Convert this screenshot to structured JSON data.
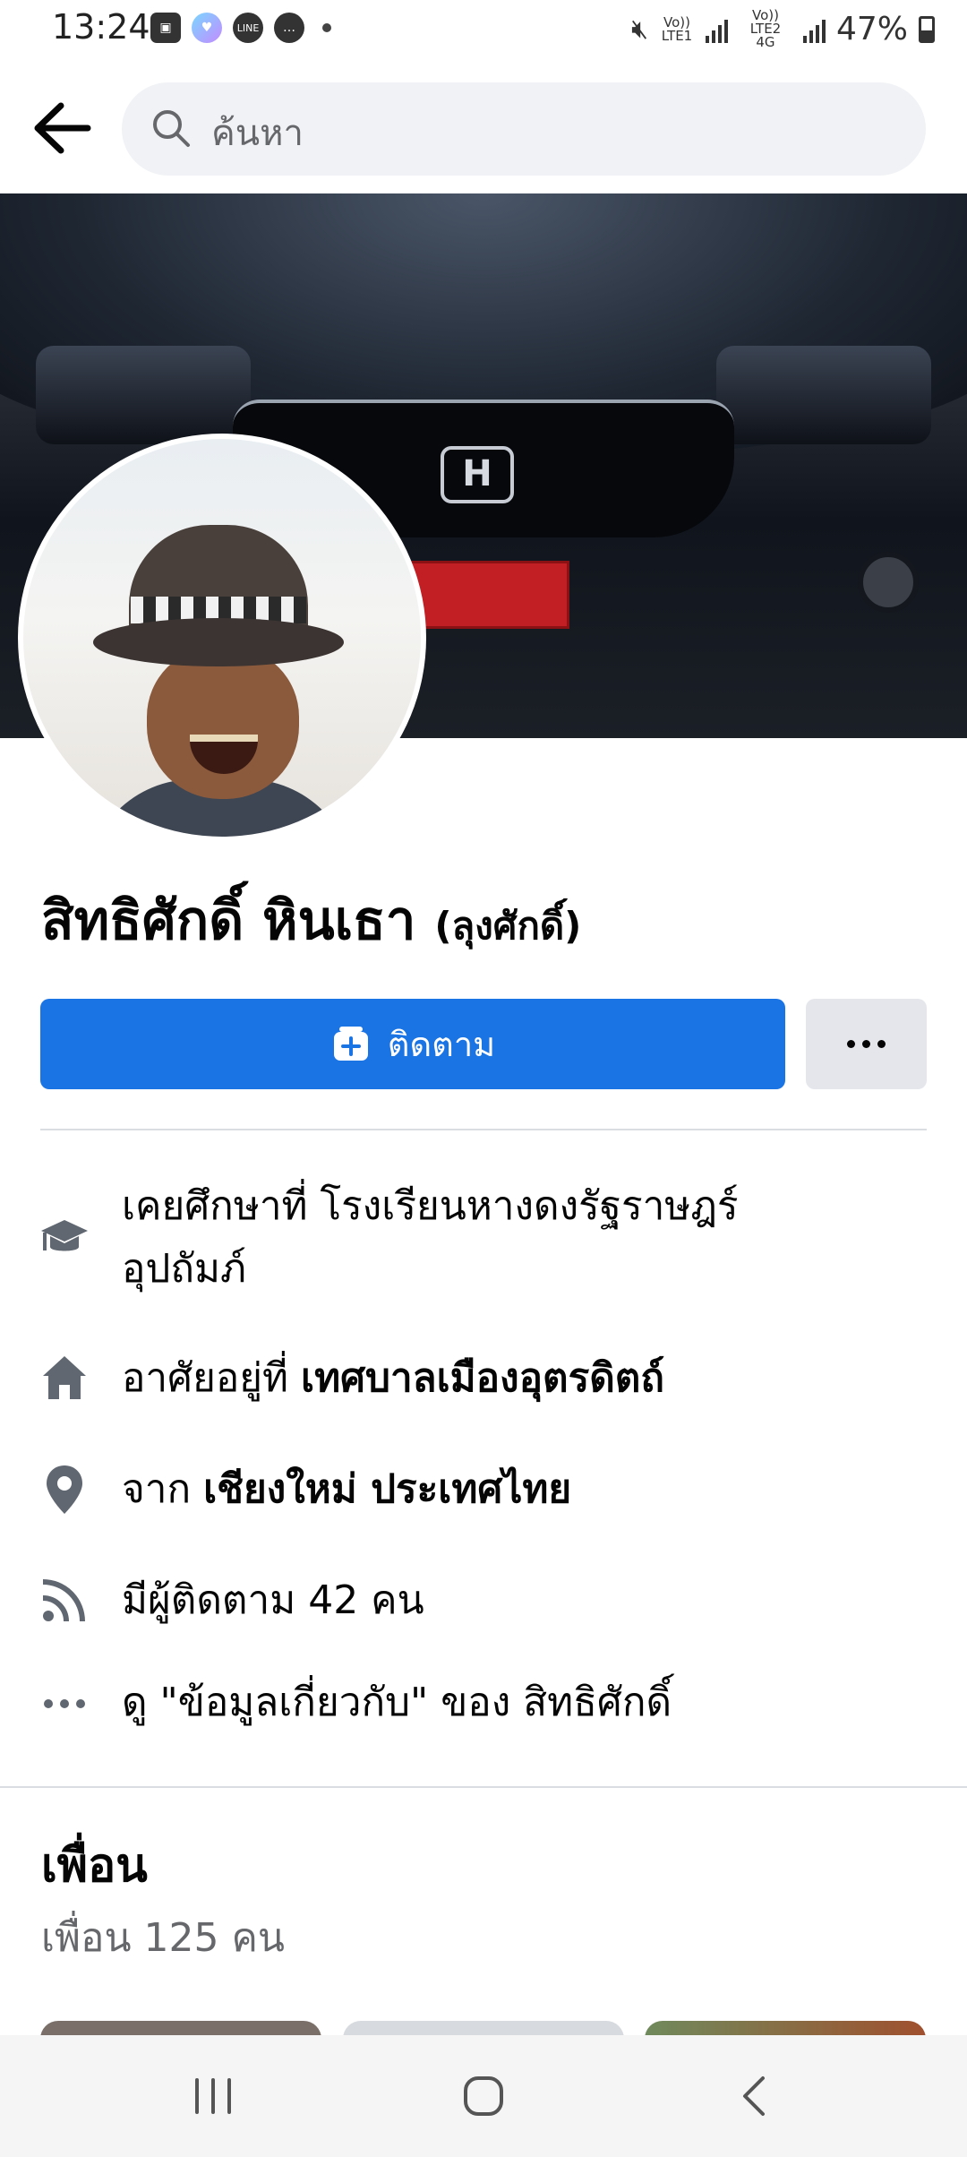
{
  "status_bar": {
    "time": "13:24",
    "battery": "47%",
    "sim1_label": "Vo)) LTE1",
    "sim2_label": "Vo)) LTE2 4G"
  },
  "search": {
    "placeholder": "ค้นหา"
  },
  "profile": {
    "name": "สิทธิศักดิ์ หินเธา",
    "alt_name": "(ลุงศักดิ์)"
  },
  "actions": {
    "follow_label": "ติดตาม",
    "more_label": "..."
  },
  "details": {
    "education_line1": "เคยศึกษาที่ โรงเรียนหางดงรัฐราษฎร์",
    "education_line2": "อุปถัมภ์",
    "lives_prefix": "อาศัยอยู่ที่ ",
    "lives_place": "เทศบาลเมืองอุตรดิตถ์",
    "from_prefix": "จาก ",
    "from_place": "เชียงใหม่ ประเทศไทย",
    "followers": "มีผู้ติดตาม 42 คน",
    "about_link": "ดู \"ข้อมูลเกี่ยวกับ\" ของ สิทธิศักดิ์"
  },
  "friends": {
    "title": "เพื่อน",
    "count": "เพื่อน 125 คน"
  },
  "colors": {
    "accent": "#1b74e4",
    "secondary_text": "#65676b",
    "button_gray": "#e4e6eb"
  }
}
